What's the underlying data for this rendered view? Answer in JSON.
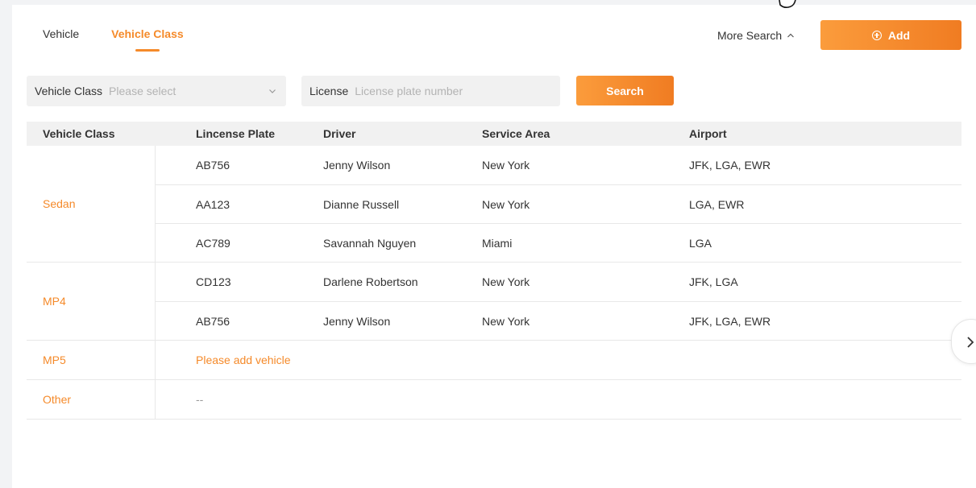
{
  "tabs": [
    {
      "label": "Vehicle",
      "active": false
    },
    {
      "label": "Vehicle Class",
      "active": true
    }
  ],
  "toolbar": {
    "more_search_label": "More Search",
    "add_label": "Add"
  },
  "filters": {
    "vehicle_class_label": "Vehicle Class",
    "vehicle_class_placeholder": "Please select",
    "license_label": "License",
    "license_placeholder": "License plate number",
    "search_label": "Search"
  },
  "table": {
    "headers": [
      "Vehicle Class",
      "Lincense Plate",
      "Driver",
      "Service Area",
      "Airport"
    ],
    "groups": [
      {
        "class": "Sedan",
        "rows": [
          {
            "plate": "AB756",
            "driver": "Jenny Wilson",
            "area": "New York",
            "airport": "JFK, LGA, EWR"
          },
          {
            "plate": "AA123",
            "driver": "Dianne Russell",
            "area": "New York",
            "airport": "LGA, EWR"
          },
          {
            "plate": "AC789",
            "driver": "Savannah Nguyen",
            "area": "Miami",
            "airport": "LGA"
          }
        ]
      },
      {
        "class": "MP4",
        "rows": [
          {
            "plate": "CD123",
            "driver": "Darlene Robertson",
            "area": "New York",
            "airport": "JFK, LGA"
          },
          {
            "plate": "AB756",
            "driver": "Jenny Wilson",
            "area": "New York",
            "airport": "JFK, LGA, EWR"
          }
        ]
      },
      {
        "class": "MP5",
        "empty_text": "Please add vehicle"
      },
      {
        "class": "Other",
        "empty_text": "--"
      }
    ]
  },
  "icons": {
    "add": "plus-circle-icon",
    "more_search": "chevron-up-icon",
    "select": "chevron-down-icon",
    "next": "chevron-right-icon",
    "cursor": "hand-cursor-icon"
  },
  "colors": {
    "accent": "#f58a2a",
    "header_bg": "#f1f1f1",
    "border": "#e8e8e8"
  }
}
